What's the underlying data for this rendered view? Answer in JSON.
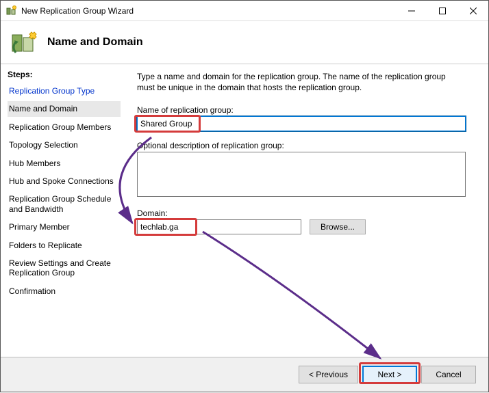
{
  "window": {
    "title": "New Replication Group Wizard"
  },
  "header": {
    "title": "Name and Domain"
  },
  "sidebar": {
    "heading": "Steps:",
    "items": [
      {
        "label": "Replication Group Type",
        "state": "done"
      },
      {
        "label": "Name and Domain",
        "state": "current"
      },
      {
        "label": "Replication Group Members",
        "state": "pending"
      },
      {
        "label": "Topology Selection",
        "state": "pending"
      },
      {
        "label": "Hub Members",
        "state": "pending"
      },
      {
        "label": "Hub and Spoke Connections",
        "state": "pending"
      },
      {
        "label": "Replication Group Schedule and Bandwidth",
        "state": "pending"
      },
      {
        "label": "Primary Member",
        "state": "pending"
      },
      {
        "label": "Folders to Replicate",
        "state": "pending"
      },
      {
        "label": "Review Settings and Create Replication Group",
        "state": "pending"
      },
      {
        "label": "Confirmation",
        "state": "pending"
      }
    ]
  },
  "main": {
    "instruction": "Type a name and domain for the replication group. The name of the replication group must be unique in the domain that hosts the replication group.",
    "name_label": "Name of replication group:",
    "name_value": "Shared Group",
    "description_label": "Optional description of replication group:",
    "description_value": "",
    "domain_label": "Domain:",
    "domain_value": "techlab.ga",
    "browse_label": "Browse..."
  },
  "footer": {
    "previous": "< Previous",
    "next": "Next >",
    "cancel": "Cancel"
  }
}
